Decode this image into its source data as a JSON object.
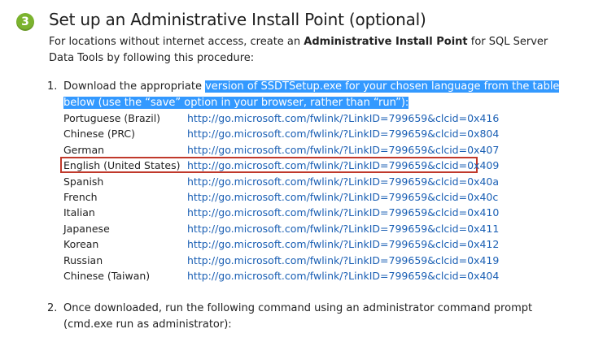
{
  "section": {
    "step_number": "3",
    "title": "Set up an Administrative Install Point (optional)",
    "intro_prefix": "For locations without internet access, create an ",
    "intro_bold": "Administrative Install Point",
    "intro_suffix": " for SQL Server Data Tools by following this procedure:"
  },
  "steps": [
    {
      "number": "1.",
      "text_plain": "Download the appropriate ",
      "text_highlighted": "version of SSDTSetup.exe for your chosen language from the table below (use the “save” option in your browser, rather than “run”):"
    },
    {
      "number": "2.",
      "text": "Once downloaded, run the following command using an administrator command prompt (cmd.exe run as administrator):"
    }
  ],
  "languages": [
    {
      "name": "Portuguese (Brazil)",
      "url": "http://go.microsoft.com/fwlink/?LinkID=799659&clcid=0x416"
    },
    {
      "name": "Chinese (PRC)",
      "url": "http://go.microsoft.com/fwlink/?LinkID=799659&clcid=0x804"
    },
    {
      "name": "German",
      "url": "http://go.microsoft.com/fwlink/?LinkID=799659&clcid=0x407"
    },
    {
      "name": "English (United States)",
      "url": "http://go.microsoft.com/fwlink/?LinkID=799659&clcid=0x409"
    },
    {
      "name": "Spanish",
      "url": "http://go.microsoft.com/fwlink/?LinkID=799659&clcid=0x40a"
    },
    {
      "name": "French",
      "url": "http://go.microsoft.com/fwlink/?LinkID=799659&clcid=0x40c"
    },
    {
      "name": "Italian",
      "url": "http://go.microsoft.com/fwlink/?LinkID=799659&clcid=0x410"
    },
    {
      "name": "Japanese",
      "url": "http://go.microsoft.com/fwlink/?LinkID=799659&clcid=0x411"
    },
    {
      "name": "Korean",
      "url": "http://go.microsoft.com/fwlink/?LinkID=799659&clcid=0x412"
    },
    {
      "name": "Russian",
      "url": "http://go.microsoft.com/fwlink/?LinkID=799659&clcid=0x419"
    },
    {
      "name": "Chinese (Taiwan)",
      "url": "http://go.microsoft.com/fwlink/?LinkID=799659&clcid=0x404"
    }
  ],
  "colors": {
    "badge": "#7bb32e",
    "link": "#1a5fb4",
    "selection": "#3399ff",
    "highlight_box": "#c0392b"
  }
}
